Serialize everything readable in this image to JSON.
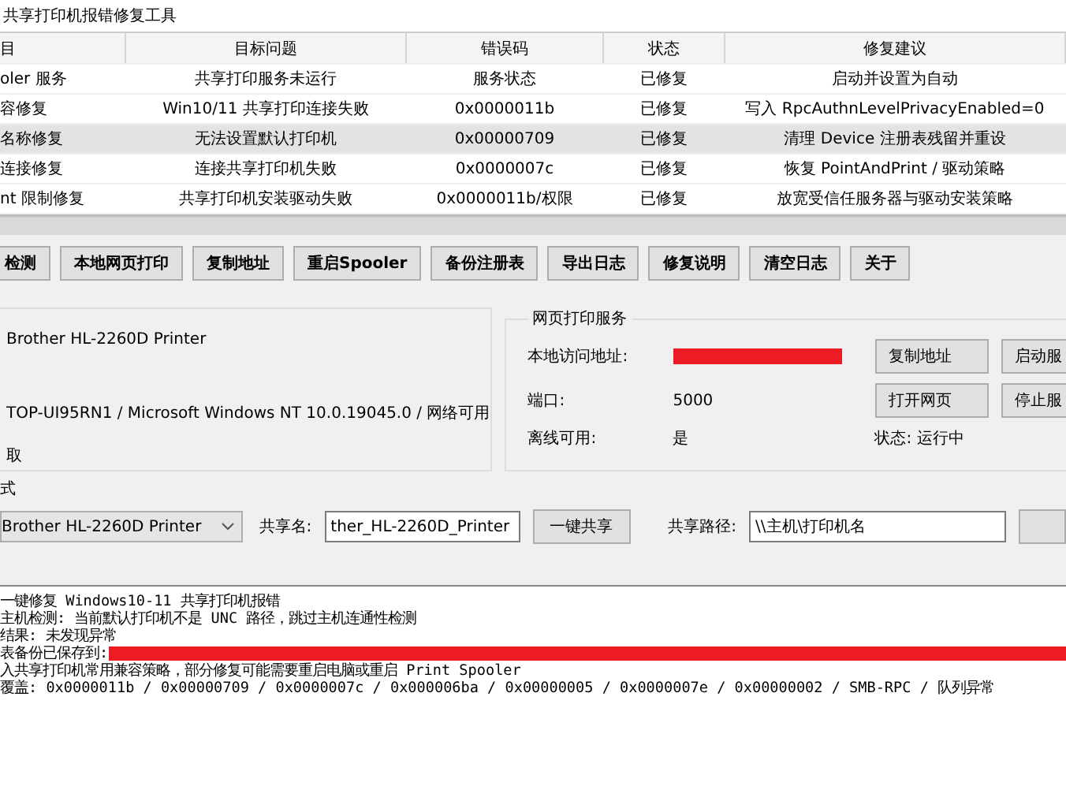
{
  "window": {
    "title": "共享打印机报错修复工具"
  },
  "table": {
    "columns": [
      "目",
      "目标问题",
      "错误码",
      "状态",
      "修复建议"
    ],
    "rows": [
      {
        "cells": [
          "oler 服务",
          "共享打印服务未运行",
          "服务状态",
          "已修复",
          "启动并设置为自动"
        ],
        "selected": false
      },
      {
        "cells": [
          "容修复",
          "Win10/11 共享打印连接失败",
          "0x0000011b",
          "已修复",
          "写入 RpcAuthnLevelPrivacyEnabled=0"
        ],
        "selected": false
      },
      {
        "cells": [
          "名称修复",
          "无法设置默认打印机",
          "0x00000709",
          "已修复",
          "清理 Device 注册表残留并重设"
        ],
        "selected": true
      },
      {
        "cells": [
          "连接修复",
          "连接共享打印机失败",
          "0x0000007c",
          "已修复",
          "恢复 PointAndPrint / 驱动策略"
        ],
        "selected": false
      },
      {
        "cells": [
          "nt 限制修复",
          "共享打印机安装驱动失败",
          "0x0000011b/权限",
          "已修复",
          "放宽受信任服务器与驱动安装策略"
        ],
        "selected": false
      }
    ]
  },
  "toolbar": [
    "检测",
    "本地网页打印",
    "复制地址",
    "重启Spooler",
    "备份注册表",
    "导出日志",
    "修复说明",
    "清空日志",
    "关于"
  ],
  "info": {
    "printer": "Brother HL-2260D Printer",
    "system": "TOP-UI95RN1 / Microsoft Windows NT 10.0.19045.0 / 网络可用",
    "note": "取"
  },
  "web_service": {
    "title": "网页打印服务",
    "fields": [
      {
        "label": "本地访问地址:",
        "redacted": true
      },
      {
        "label": "端口:",
        "redacted": false,
        "value": "5000"
      },
      {
        "label": "离线可用:",
        "redacted": false,
        "value": "是"
      }
    ],
    "buttons": [
      "复制地址",
      "启动服",
      "打开网页",
      "停止服"
    ],
    "status": "状态: 运行中"
  },
  "share": {
    "title": "式",
    "printer": "Brother HL-2260D Printer",
    "name_label": "共享名:",
    "name_value": "ther_HL-2260D_Printer",
    "share_button": "一键共享",
    "path_label": "共享路径:",
    "path_value": "\\\\主机\\打印机名"
  },
  "log": [
    {
      "text": "一键修复 Windows10-11 共享打印机报错",
      "redacted": false
    },
    {
      "text": "主机检测: 当前默认打印机不是 UNC 路径，跳过主机连通性检测",
      "redacted": false
    },
    {
      "text": "结果: 未发现异常",
      "redacted": false
    },
    {
      "text": "表备份已保存到:",
      "redacted": true
    },
    {
      "text": "入共享打印机常用兼容策略，部分修复可能需要重启电脑或重启 Print Spooler",
      "redacted": false
    },
    {
      "text": "覆盖: 0x0000011b / 0x00000709 / 0x0000007c / 0x000006ba / 0x00000005 / 0x0000007e / 0x00000002 / SMB-RPC / 队列异常",
      "redacted": false
    }
  ]
}
